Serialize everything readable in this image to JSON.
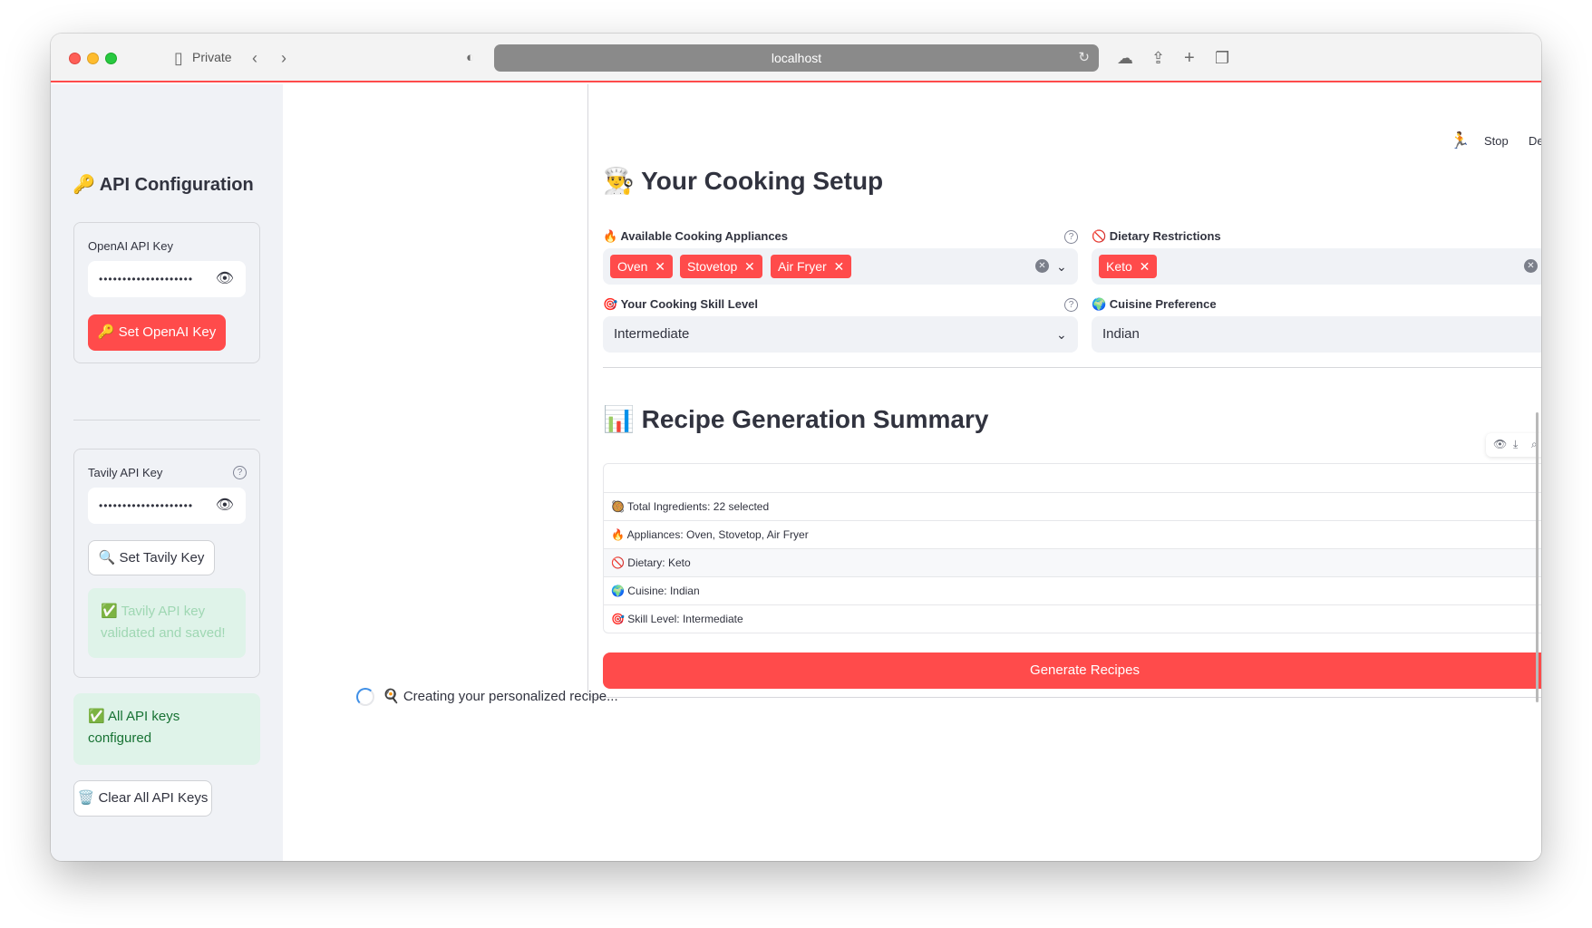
{
  "browser": {
    "private_label": "Private",
    "url": "localhost"
  },
  "topbar": {
    "stop": "Stop",
    "deploy": "Deploy"
  },
  "sidebar": {
    "title": "🔑 API Configuration",
    "openai": {
      "label": "OpenAI API Key",
      "value": "••••••••••••••••••••",
      "button": "🔑 Set OpenAI Key"
    },
    "tavily": {
      "label": "Tavily API Key",
      "value": "••••••••••••••••••••",
      "button": "🔍 Set Tavily Key",
      "success": "✅ Tavily API key validated and saved!"
    },
    "all_configured": "✅ All API keys configured",
    "clear_button": "🗑️ Clear All API Keys"
  },
  "setup": {
    "title": "👨‍🍳 Your Cooking Setup",
    "appliances_label": "🔥 Available Cooking Appliances",
    "appliances": [
      "Oven",
      "Stovetop",
      "Air Fryer"
    ],
    "dietary_label": "🚫 Dietary Restrictions",
    "dietary": [
      "Keto"
    ],
    "skill_label": "🎯 Your Cooking Skill Level",
    "skill_value": "Intermediate",
    "cuisine_label": "🌍 Cuisine Preference",
    "cuisine_value": "Indian"
  },
  "summary": {
    "title": "📊 Recipe Generation Summary",
    "rows": [
      "🥘 Total Ingredients: 22 selected",
      "🔥 Appliances: Oven, Stovetop, Air Fryer",
      "🚫 Dietary: Keto",
      "🌍 Cuisine: Indian",
      "🎯 Skill Level: Intermediate"
    ],
    "generate_button": "Generate Recipes"
  },
  "status": {
    "spinner_text": "🍳 Creating your personalized recipe..."
  }
}
